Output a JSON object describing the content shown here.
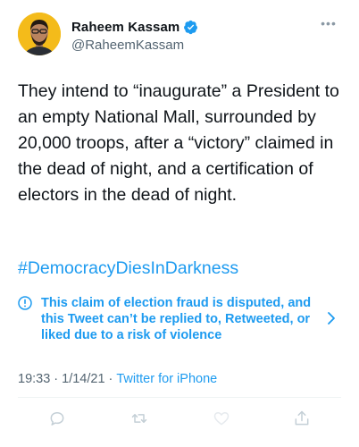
{
  "user": {
    "display_name": "Raheem Kassam",
    "handle": "@RaheemKassam",
    "verified": true,
    "avatar_bg": "#f4bb1a"
  },
  "tweet": {
    "text": "They intend to “inaugurate” a President to an empty National Mall, surrounded by 20,000 troops, after a “victory” claimed in the dead of night, and a certification of electors in the dead of night.",
    "hashtag": "#DemocracyDiesInDarkness"
  },
  "notice": {
    "text": "This claim of election fraud is disputed, and this Tweet can’t be replied to, Retweeted, or liked due to a risk of violence",
    "icon": "info-circle-icon"
  },
  "meta": {
    "time": "19:33",
    "separator": "·",
    "date": "1/14/21",
    "source_separator": "·",
    "source": "Twitter for iPhone"
  },
  "icons": {
    "reply": "reply-icon",
    "retweet": "retweet-icon",
    "like": "like-icon",
    "share": "share-icon",
    "more": "more-icon"
  },
  "colors": {
    "accent": "#1d9bf0",
    "text": "#0f1419",
    "muted": "#536471",
    "disabled_action": "#c4cfd6"
  }
}
